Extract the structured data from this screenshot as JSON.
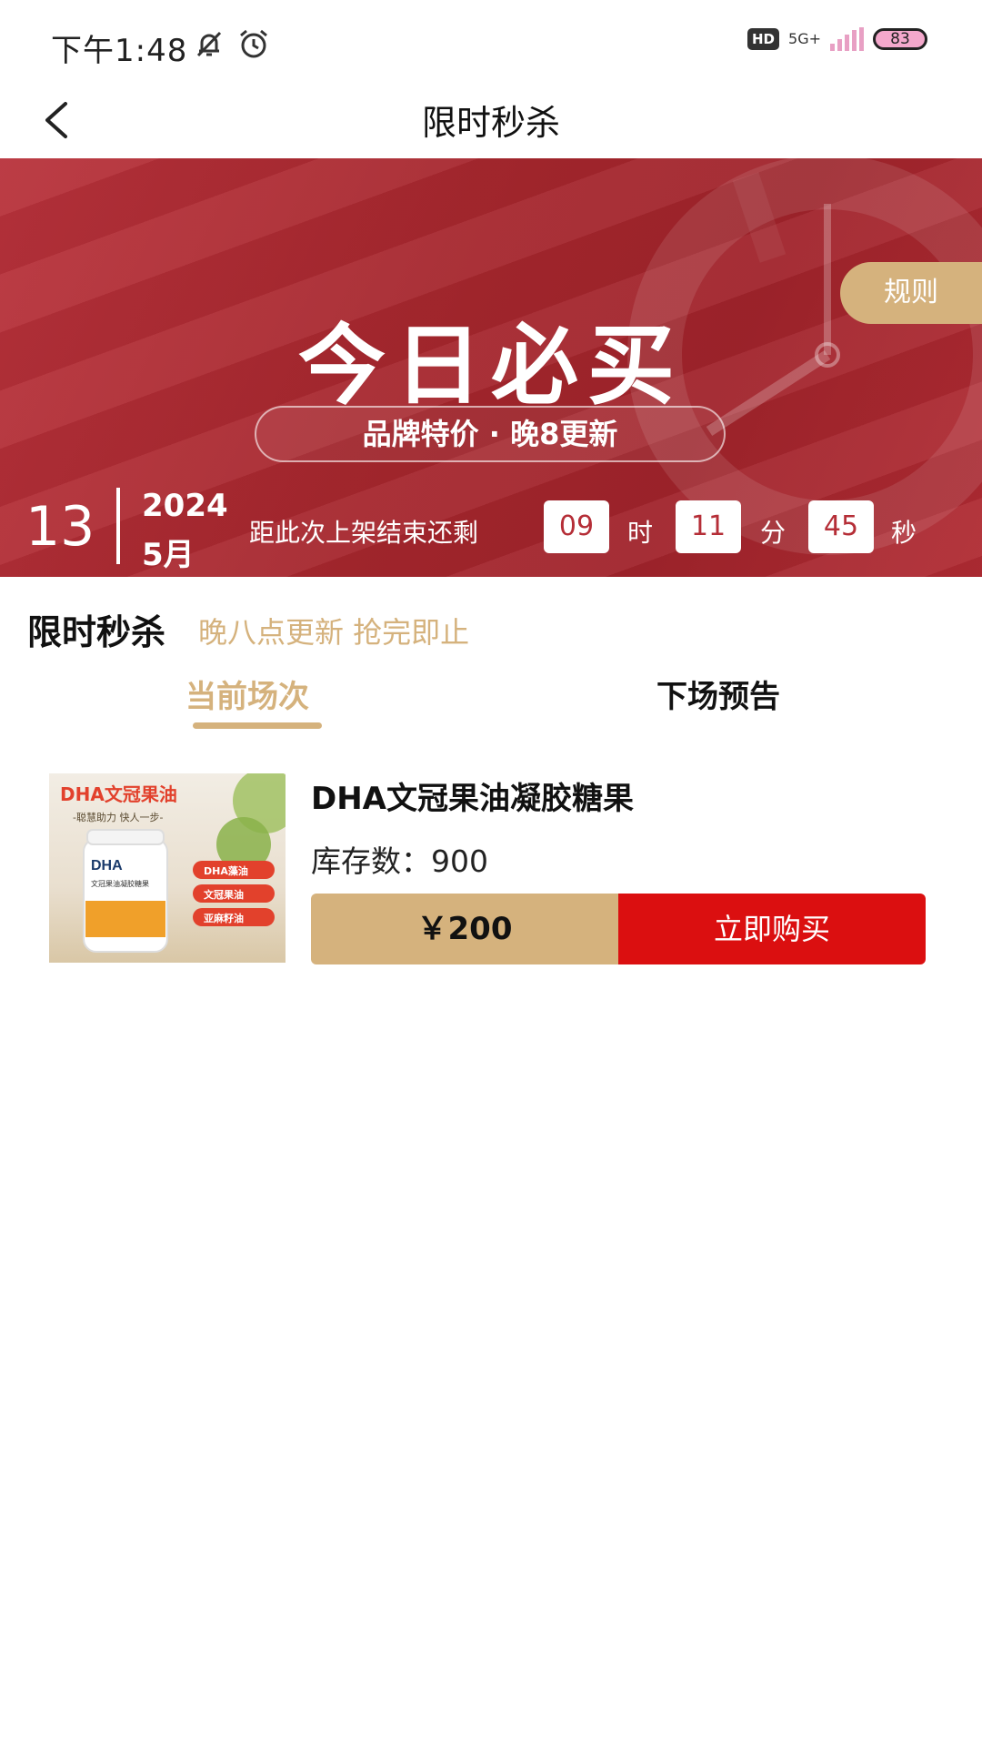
{
  "status_bar": {
    "time": "下午1:48",
    "network": "5G+",
    "hd_badge": "HD",
    "battery": "83"
  },
  "header": {
    "title": "限时秒杀",
    "back_icon": "chevron-left-icon"
  },
  "banner": {
    "headline": "今日必买",
    "subtitle": "品牌特价 · 晚8更新",
    "rules_label": "规则",
    "date": {
      "day": "13",
      "year": "2024",
      "month": "5月"
    },
    "countdown": {
      "label": "距此次上架结束还剩",
      "hours": "09",
      "hours_unit": "时",
      "minutes": "11",
      "minutes_unit": "分",
      "seconds": "45",
      "seconds_unit": "秒"
    },
    "colors": {
      "primary": "#a5262d",
      "gold": "#d5b27d"
    }
  },
  "section": {
    "title": "限时秒杀",
    "subtitle": "晚八点更新 抢完即止"
  },
  "tabs": [
    {
      "label": "当前场次",
      "active": true
    },
    {
      "label": "下场预告",
      "active": false
    }
  ],
  "products": [
    {
      "name": "DHA文冠果油凝胶糖果",
      "stock_label": "库存数：",
      "stock_value": "900",
      "price": "￥200",
      "buy_label": "立即购买",
      "image": {
        "title": "DHA文冠果油",
        "slogan": "-聪慧助力 快人一步-",
        "bottle_label": "DHA",
        "bottle_sub": "文冠果油凝胶糖果",
        "badges": [
          "DHA藻油",
          "文冠果油",
          "亚麻籽油"
        ]
      }
    }
  ],
  "colors": {
    "accent_gold": "#d5b27d",
    "buy_red": "#db0f10"
  }
}
